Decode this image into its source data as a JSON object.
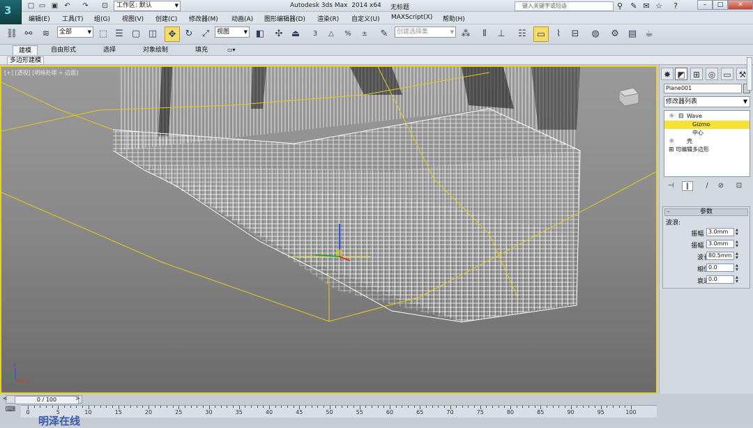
{
  "app": {
    "logo": "3",
    "title": "Autodesk 3ds Max  2014 x64",
    "document": "无标题"
  },
  "quick_access": [
    "new-icon",
    "open-icon",
    "save-icon",
    "undo-icon",
    "redo-icon",
    "hold-icon"
  ],
  "workspace": {
    "label": "工作区: 默认"
  },
  "search": {
    "placeholder": "键入关键字或短语"
  },
  "menu": [
    "编辑(E)",
    "工具(T)",
    "组(G)",
    "视图(V)",
    "创建(C)",
    "修改器(M)",
    "动画(A)",
    "图形编辑器(D)",
    "渲染(R)",
    "自定义(U)",
    "MAXScript(X)",
    "帮助(H)"
  ],
  "toolbar": {
    "selection_filter": "全部",
    "ref_coord": "视图",
    "named_selection_placeholder": "创建选择集",
    "snap_label": "3",
    "angle_snap_label": "△",
    "percent_snap_label": "%",
    "spinner_snap_label": "±"
  },
  "ribbon": {
    "tabs": [
      "建模",
      "自由形式",
      "选择",
      "对象绘制",
      "填充"
    ],
    "active": "建模",
    "sub": "多边形建模"
  },
  "viewport": {
    "label": "[+] [透视] [明暗处理 + 边面]",
    "axis_x": "x",
    "axis_y": "y",
    "axis_z": "z"
  },
  "command_panel": {
    "object_name": "Plane001",
    "modifier_list": "修改器列表",
    "stack": [
      {
        "label": "Wave",
        "level": 0
      },
      {
        "label": "Gizmo",
        "level": 1,
        "selected": true
      },
      {
        "label": "中心",
        "level": 1
      },
      {
        "label": "壳",
        "level": 0
      },
      {
        "label": "可编辑多边形",
        "level": 0
      }
    ],
    "rollout": {
      "title": "参数",
      "group": "波浪:",
      "params": [
        {
          "label": "振幅 1:",
          "value": "3.0mm"
        },
        {
          "label": "振幅 2:",
          "value": "3.0mm"
        },
        {
          "label": "波长:",
          "value": "80.5mm"
        },
        {
          "label": "相位:",
          "value": "0.0"
        },
        {
          "label": "衰退:",
          "value": "0.0"
        }
      ]
    }
  },
  "timeline": {
    "slider": "0 / 100",
    "ticks": [
      0,
      5,
      10,
      15,
      20,
      25,
      30,
      35,
      40,
      45,
      50,
      55,
      60,
      65,
      70,
      75,
      80,
      85,
      90,
      95,
      100
    ]
  },
  "watermark": "明泽在线",
  "colors": {
    "selection_border": "#e8d21f",
    "gizmo": "#e2cd1a",
    "highlight": "#f5e23a"
  }
}
